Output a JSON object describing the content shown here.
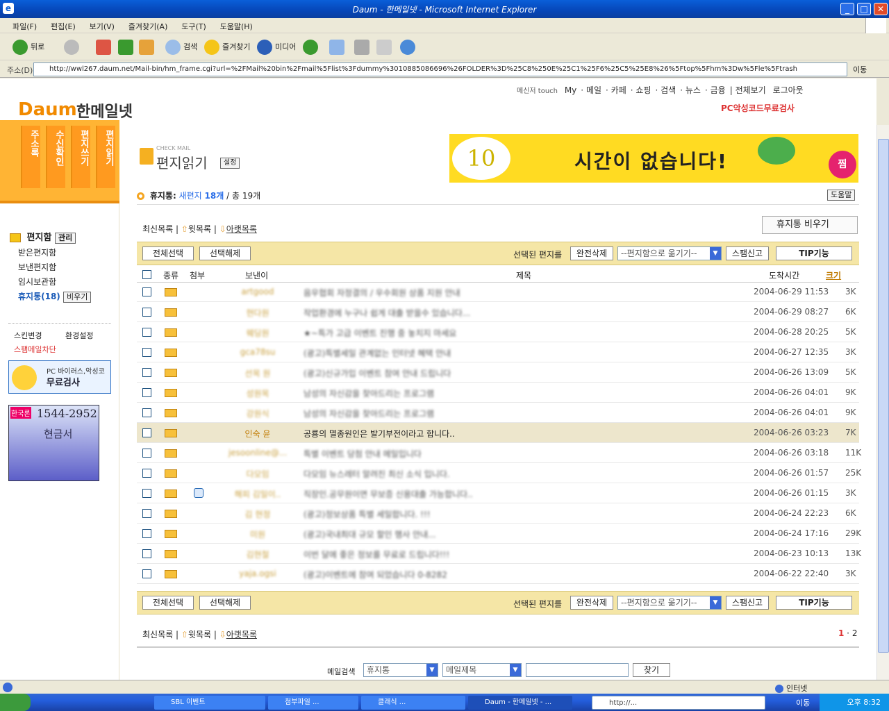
{
  "window": {
    "title": "Daum - 한메일넷 - Microsoft Internet Explorer"
  },
  "menu": [
    "파일(F)",
    "편집(E)",
    "보기(V)",
    "즐겨찾기(A)",
    "도구(T)",
    "도움말(H)"
  ],
  "toolbar": {
    "back": "뒤로",
    "search": "검색",
    "favorites": "즐겨찾기",
    "media": "미디어"
  },
  "address": {
    "label": "주소(D)",
    "url": "http://wwl267.daum.net/Mail-bin/hm_frame.cgi?url=%2FMail%20bin%2Fmail%5Flist%3Fdummy%3010885086696%26FOLDER%3D%25C8%250E%25C1%25F6%25C5%25E8%26%5Ftop%5Fhm%3Dw%5Fle%5Ftrash",
    "go": "이동"
  },
  "top": {
    "logo_daum": "Daum",
    "logo_han": "한메일넷",
    "messenger": "메신저 touch",
    "nav": [
      "My",
      "메일",
      "카페",
      "쇼핑",
      "검색",
      "뉴스",
      "금융",
      "전체보기",
      "로그아웃"
    ],
    "pc_check": "PC악성코드무료검사"
  },
  "left": {
    "tabs": [
      "주소록",
      "수신확인",
      "편지쓰기",
      "편지읽기"
    ],
    "mailbox_title": "편지함",
    "manage": "관리",
    "folders": [
      "받은편지함",
      "보낸편지함",
      "임시보관함",
      "휴지통(18)"
    ],
    "empty": "비우기",
    "skin": "스킨변경",
    "settings": "환경설정",
    "spam": "스팸메일차단",
    "virus_line1": "PC 바이러스,악성코드",
    "virus_line2": "무료검사",
    "ad_phone": "1544-2952",
    "ad_brand": "한국론",
    "ad_text": "현금서"
  },
  "main": {
    "page_title": "편지읽기",
    "settings_btn": "설정",
    "check_mail": "CHECK MAIL",
    "banner_num": "10",
    "banner_text": "시간이 없습니다!",
    "banner_badge": "찜",
    "folder_name": "휴지통:",
    "new_label": "새편지",
    "new_count": "18개",
    "total": "/ 총 19개",
    "help": "도움말",
    "nav_latest": "최신목록",
    "nav_up": "윗목록",
    "nav_down": "아랫목록",
    "empty_trash": "휴지통 비우기",
    "select_all": "전체선택",
    "deselect": "선택해제",
    "selected_label": "선택된 편지를",
    "delete_btn": "완전삭제",
    "move_select": "--편지함으로 옮기기--",
    "spam_btn": "스팸신고",
    "tip_btn": "TIP기능",
    "headers": {
      "type": "종류",
      "attach": "첨부",
      "sender": "보낸이",
      "subject": "제목",
      "date": "도착시간",
      "size": "크기"
    },
    "rows": [
      {
        "sender": "artgood",
        "subject": "음우협회 자정결의 / 우수회원 상품 지원 안내",
        "date": "2004-06-29 11:53",
        "size": "3K"
      },
      {
        "sender": "현다원",
        "subject": "작업환경에 누구나 쉽게 대출 받을수 있습니다...",
        "date": "2004-06-29 08:27",
        "size": "6K"
      },
      {
        "sender": "웨딩원",
        "subject": "★~특가 고급 이벤트 진행 중 놓치지 마세요",
        "date": "2004-06-28 20:25",
        "size": "5K"
      },
      {
        "sender": "gca78su",
        "subject": "(광고)특별세일 관계없는 인터넷 혜택 안내",
        "date": "2004-06-27 12:35",
        "size": "3K"
      },
      {
        "sender": "선목 원",
        "subject": "(광고)신규가입 이벤트 참여 안내 드립니다",
        "date": "2004-06-26 13:09",
        "size": "5K"
      },
      {
        "sender": "성원목",
        "subject": "남성의 자신감을 찾아드리는 프로그램",
        "date": "2004-06-26 04:01",
        "size": "9K"
      },
      {
        "sender": "강원식",
        "subject": "남성의 자신감을 찾아드리는 프로그램",
        "date": "2004-06-26 04:01",
        "size": "9K"
      },
      {
        "sender": "인숙 윤",
        "subject": "공룡의 멸종원인은 발기부전이라고 합니다..",
        "date": "2004-06-26 03:23",
        "size": "7K",
        "hl": true
      },
      {
        "sender": "jesoonline@...",
        "subject": "특별 이벤트 당첨 안내 메일입니다",
        "date": "2004-06-26 03:18",
        "size": "11K"
      },
      {
        "sender": "다모임",
        "subject": "다모임 뉴스레터 알려진 최신 소식 입니다.",
        "date": "2004-06-26 01:57",
        "size": "25K"
      },
      {
        "sender": "해피 김일이..",
        "subject": "직장인.공무원이면 무보증 신용대출 가능합니다..",
        "date": "2004-06-26 01:15",
        "size": "3K",
        "att": true
      },
      {
        "sender": "김 현정",
        "subject": "(광고)정보상품 특별 세일합니다. !!!",
        "date": "2004-06-24 22:23",
        "size": "6K"
      },
      {
        "sender": "미원",
        "subject": "(광고)국내최대 규모 할인 행사 안내...",
        "date": "2004-06-24 17:16",
        "size": "29K"
      },
      {
        "sender": "김현철",
        "subject": "이번 달에 좋은 정보를 무료로 드립니다!!!",
        "date": "2004-06-23 10:13",
        "size": "13K"
      },
      {
        "sender": "yaja.ogsi",
        "subject": "(광고)이벤트에 참여 되었습니다 0-8282",
        "date": "2004-06-22 22:40",
        "size": "3K"
      }
    ],
    "pages": [
      "1",
      "2"
    ],
    "search_label": "메일검색",
    "search_folder": "휴지통",
    "search_field": "메일제목",
    "search_btn": "찾기"
  },
  "status": {
    "zone": "인터넷"
  },
  "taskbar": {
    "tasks": [
      "SBL 이벤트",
      "첨부파일 ...",
      "클래식 ...",
      "Daum - 한메일넷 - ...",
      "http://..."
    ],
    "time": "오후 8:32",
    "go": "이동"
  }
}
